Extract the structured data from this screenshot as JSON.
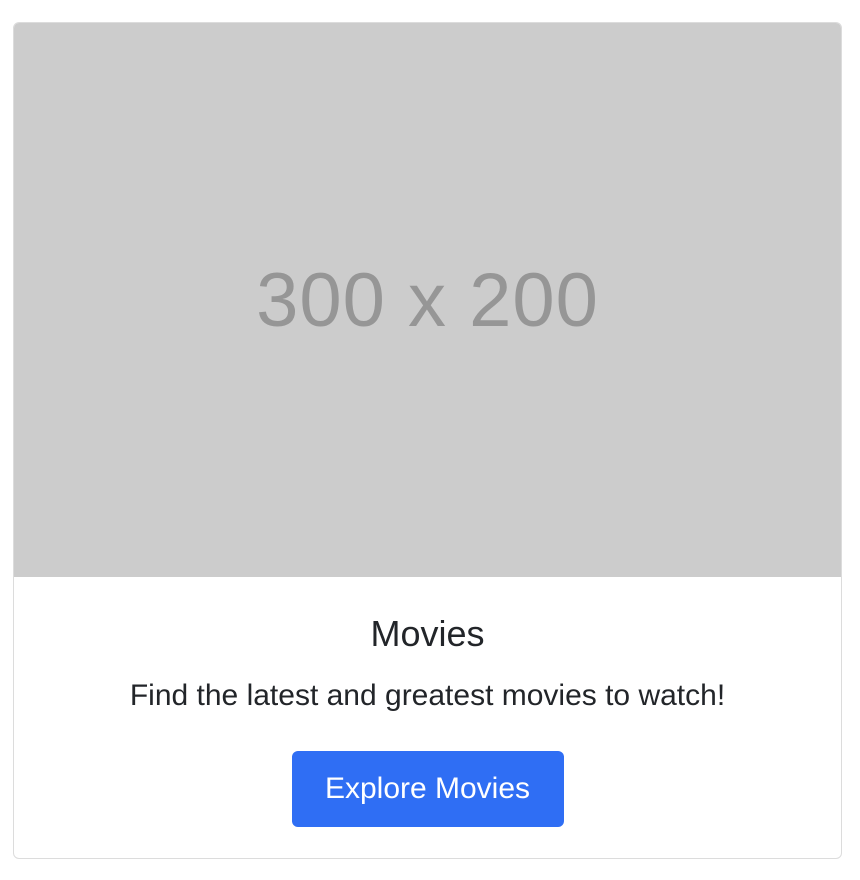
{
  "card": {
    "image_placeholder": "300 x 200",
    "title": "Movies",
    "description": "Find the latest and greatest movies to watch!",
    "button_label": "Explore Movies"
  },
  "colors": {
    "image_background": "#cccccc",
    "placeholder_text": "#969696",
    "button_background": "#2f6ef4",
    "text": "#222529"
  }
}
